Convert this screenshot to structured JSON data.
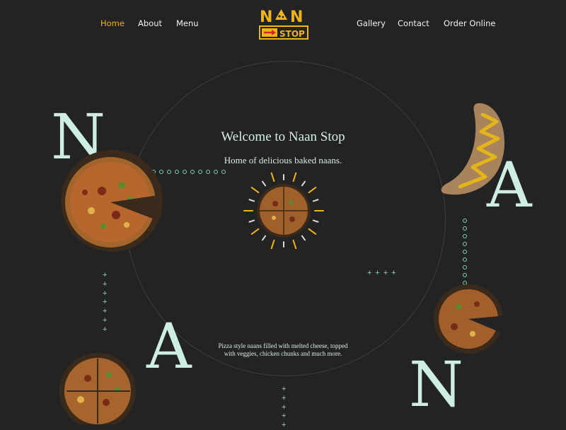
{
  "nav": {
    "home": "Home",
    "about": "About",
    "menu": "Menu",
    "gallery": "Gallery",
    "contact": "Contact",
    "order": "Order Online"
  },
  "logo": {
    "top": "NAN",
    "bottom": "STOP"
  },
  "hero": {
    "title": "Welcome to Naan Stop",
    "subtitle": "Home of delicious baked naans.",
    "description_line1": "Pizza style naans filled with melted cheese, topped",
    "description_line2": "with veggies, chicken chunks and much more."
  },
  "letters": {
    "n1": "N",
    "a1": "A",
    "a2": "A",
    "n2": "N"
  },
  "colors": {
    "background": "#232323",
    "accent": "#f0b31c",
    "mint": "#cdeee1"
  }
}
